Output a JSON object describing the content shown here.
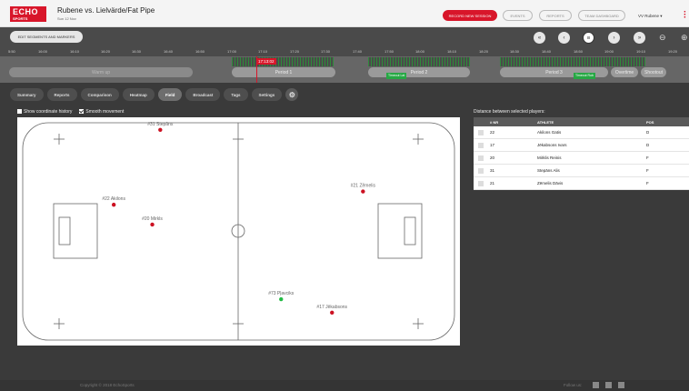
{
  "header": {
    "logo_line1": "ECHO",
    "logo_line2": "SPORTS",
    "title": "Rubene vs. Lielvärde/Fat Pipe",
    "date": "Sun 12 Nov",
    "buttons": [
      "RECORD NEW SESSION",
      "EVENTS",
      "REPORTS",
      "TEAM DASHBOARD"
    ],
    "user": "VV Rubene ▾"
  },
  "toolbar": {
    "edit_label": "EDIT SEGMENTS AND MARKERS",
    "controls": [
      "«",
      "‹",
      "II",
      "›",
      "»"
    ]
  },
  "timeline": {
    "ticks": [
      "5:50",
      "16:00",
      "16:10",
      "16:20",
      "16:30",
      "16:40",
      "16:50",
      "17:00",
      "17:10",
      "17:20",
      "17:30",
      "17:40",
      "17:50",
      "18:00",
      "18:10",
      "18:20",
      "18:30",
      "18:40",
      "18:50",
      "19:00",
      "19:10",
      "19:20"
    ],
    "current_time": "17:13:02",
    "segments": [
      "Warm up",
      "Period 1",
      "Period 2",
      "Period 3",
      "Overtime",
      "Shootout"
    ],
    "event_labels": [
      "Timeout Lat",
      "Timeout Rub"
    ]
  },
  "tabs": [
    "Summary",
    "Reports",
    "Comparison",
    "Heatmap",
    "Field",
    "Broadcast",
    "Tags",
    "Settings"
  ],
  "active_tab": "Field",
  "options": {
    "coord_history": "Show coordinate history",
    "smooth": "Smooth movement"
  },
  "players_on_field": [
    {
      "label": "#31 Stepāns",
      "color": "#cc1122",
      "fx": 0.323,
      "fy": 0.055
    },
    {
      "label": "#22 Akilons",
      "color": "#cc1122",
      "fx": 0.218,
      "fy": 0.383
    },
    {
      "label": "#20 Mirkls",
      "color": "#cc1122",
      "fx": 0.305,
      "fy": 0.47
    },
    {
      "label": "#21 Zēmelis",
      "color": "#cc1122",
      "fx": 0.781,
      "fy": 0.325
    },
    {
      "label": "#73 Pļavciks",
      "color": "#22bb44",
      "fx": 0.596,
      "fy": 0.797
    },
    {
      "label": "#17 Jēkabsons",
      "color": "#cc1122",
      "fx": 0.711,
      "fy": 0.856
    }
  ],
  "distance": {
    "title": "Distance between selected players:",
    "headers": [
      "# NR",
      "ATHLETE",
      "POS"
    ],
    "rows": [
      {
        "nr": "22",
        "athlete": "Akilons Gatis",
        "pos": "D"
      },
      {
        "nr": "17",
        "athlete": "Jēkabsons Ivars",
        "pos": "D"
      },
      {
        "nr": "20",
        "athlete": "Mirklis Reinis",
        "pos": "F"
      },
      {
        "nr": "31",
        "athlete": "Stepāns Alis",
        "pos": "F"
      },
      {
        "nr": "21",
        "athlete": "Zēmelis Dāvis",
        "pos": "F"
      }
    ]
  },
  "footer": {
    "copyright": "Copyright © 2018 EchoSports",
    "follow": "Follow us:"
  }
}
